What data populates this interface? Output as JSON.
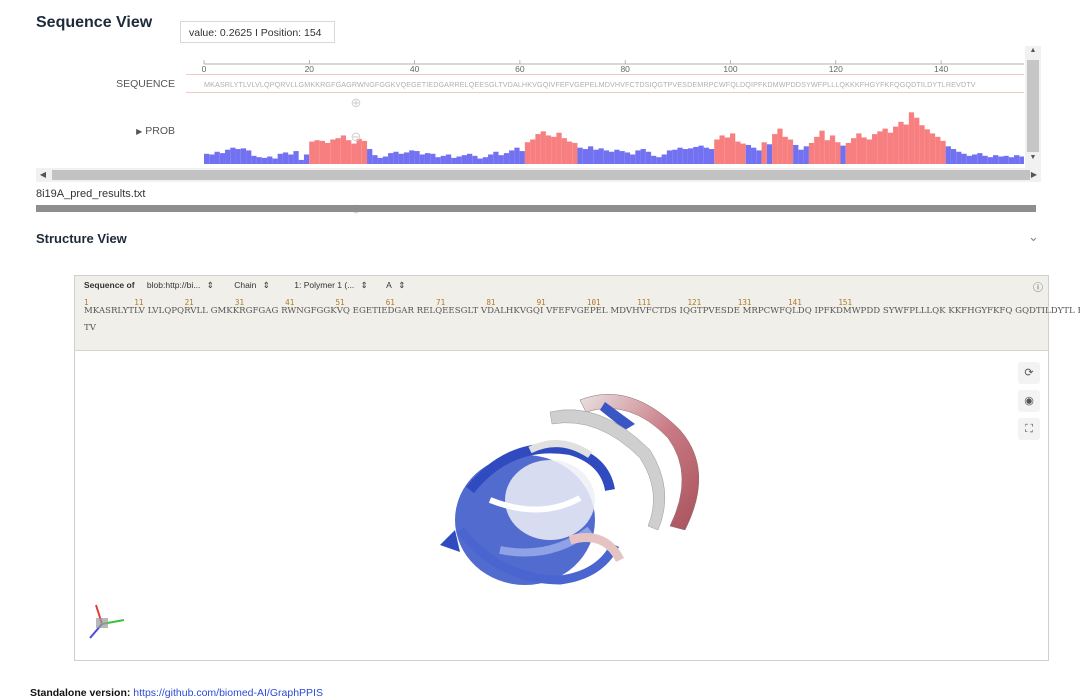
{
  "sequence_view": {
    "title": "Sequence View",
    "tooltip": "value: 0.2625 I Position: 154",
    "sequence_label": "SEQUENCE",
    "prob_label": "PROB",
    "sequence_text": "MKASRLYTLVLVLQPQRVLLGMKKRGFGAGRWNGFGGKVQEGETIEDGARRELQEESGLTVDALHKVGQIVFEFVGEPELMDVHVFCTDSIQGTPVESDEMRPCWFQLDQIPFKDMWPDDSYWFPLLLQKKKFHGYFKFQGQDTILDYTLREVDTV",
    "ruler_ticks": [
      "0",
      "20",
      "40",
      "60",
      "80",
      "100",
      "120",
      "140"
    ],
    "file_name": "8i19A_pred_results.txt",
    "prob_values": [
      0.15,
      0.14,
      0.18,
      0.16,
      0.21,
      0.24,
      0.22,
      0.23,
      0.2,
      0.12,
      0.1,
      0.09,
      0.11,
      0.08,
      0.15,
      0.17,
      0.14,
      0.19,
      0.06,
      0.14,
      0.33,
      0.35,
      0.34,
      0.31,
      0.36,
      0.38,
      0.42,
      0.35,
      0.3,
      0.37,
      0.34,
      0.22,
      0.13,
      0.09,
      0.11,
      0.16,
      0.18,
      0.15,
      0.17,
      0.2,
      0.19,
      0.14,
      0.16,
      0.15,
      0.1,
      0.12,
      0.14,
      0.09,
      0.11,
      0.13,
      0.15,
      0.12,
      0.08,
      0.1,
      0.14,
      0.18,
      0.13,
      0.16,
      0.2,
      0.24,
      0.19,
      0.32,
      0.36,
      0.44,
      0.48,
      0.42,
      0.4,
      0.46,
      0.38,
      0.33,
      0.31,
      0.24,
      0.22,
      0.26,
      0.21,
      0.23,
      0.2,
      0.18,
      0.21,
      0.19,
      0.17,
      0.14,
      0.2,
      0.22,
      0.18,
      0.12,
      0.1,
      0.14,
      0.2,
      0.21,
      0.24,
      0.22,
      0.23,
      0.25,
      0.27,
      0.24,
      0.22,
      0.36,
      0.42,
      0.39,
      0.45,
      0.33,
      0.3,
      0.28,
      0.24,
      0.2,
      0.32,
      0.29,
      0.44,
      0.52,
      0.4,
      0.36,
      0.28,
      0.21,
      0.26,
      0.31,
      0.4,
      0.49,
      0.35,
      0.42,
      0.32,
      0.27,
      0.31,
      0.38,
      0.45,
      0.39,
      0.36,
      0.44,
      0.48,
      0.52,
      0.46,
      0.55,
      0.62,
      0.58,
      0.76,
      0.68,
      0.57,
      0.51,
      0.45,
      0.4,
      0.34,
      0.26,
      0.22,
      0.18,
      0.15,
      0.12,
      0.14,
      0.16,
      0.12,
      0.1,
      0.13,
      0.11,
      0.12,
      0.1,
      0.13,
      0.11,
      0.1,
      0.12
    ],
    "colors": {
      "high": "#f77f7f",
      "low": "#7171f2",
      "threshold": 0.3
    }
  },
  "structure_view": {
    "title": "Structure View",
    "toolbar": {
      "sequence_of": "Sequence of",
      "blob": "blob:http://bi...",
      "chain": "Chain",
      "polymer": "1: Polymer 1 (...",
      "chain_id": "A"
    },
    "numbers_line": "1          11         21         31         41         51         61         71         81         91         101        111        121        131        141        151",
    "residues_line": "MKASRLYTLV LVLQPQRVLL GMKKRGFGAG RWNGFGGKVQ EGETIEDGAR RELQEESGLT VDALHKVGQI VFEFVGEPEL MDVHVFCTDS IQGTPVESDE MRPCWFQLDQ IPFKDMWPDD SYWFPLLLQK KKFHGYFKFQ GQDTILDYTL REVD",
    "residues_line2": "TV"
  },
  "footer": {
    "label": "Standalone version:",
    "link": "https://github.com/biomed-AI/GraphPPIS"
  }
}
